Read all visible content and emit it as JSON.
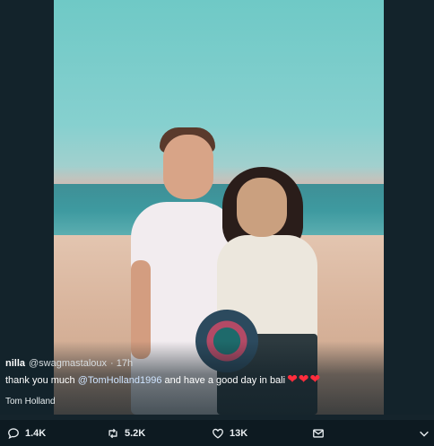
{
  "tweet": {
    "name": "nilla",
    "handle": "@swagmastaloux",
    "time": "· 17h",
    "text_before": "thank you much ",
    "mention": "@TomHolland1996",
    "text_after": " and have a good day in bali",
    "hearts": "❤❤❤",
    "tagged": "Tom Holland"
  },
  "actions": {
    "reply_count": "1.4K",
    "retweet_count": "5.2K",
    "like_count": "13K"
  },
  "colors": {
    "background": "#13232b",
    "heart": "#ff2d3d"
  },
  "icons": [
    "reply-icon",
    "retweet-icon",
    "like-icon",
    "message-icon",
    "chevron-down-icon"
  ]
}
